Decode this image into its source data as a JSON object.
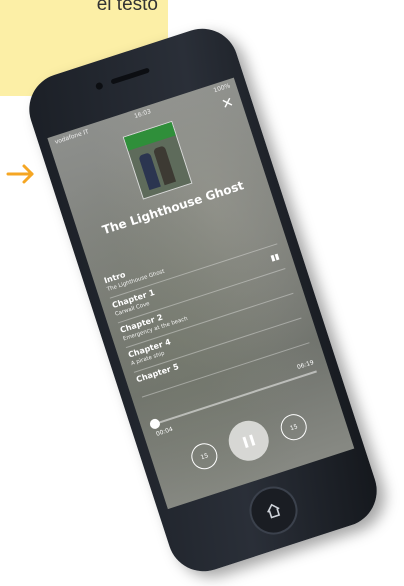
{
  "callout": {
    "text": "el testo"
  },
  "colors": {
    "callout_bg": "#fcefa6",
    "arrow": "#f5a623",
    "phone_body": "#1b1f26"
  },
  "status_bar": {
    "carrier": "vodafone IT",
    "time": "16:03",
    "battery": "100%"
  },
  "player": {
    "close_icon": "close-icon",
    "book_title": "The Lighthouse Ghost",
    "chapters": [
      {
        "title": "Intro",
        "subtitle": "The Lighthouse Ghost"
      },
      {
        "title": "Chapter 1",
        "subtitle": "Carwall Cove",
        "icon": "now-playing-icon"
      },
      {
        "title": "Chapter 2",
        "subtitle": "Emergency at the beach"
      },
      {
        "title": "Chapter 4",
        "subtitle": "A pirate ship"
      },
      {
        "title": "Chapter 5",
        "subtitle": ""
      }
    ],
    "elapsed": "00:04",
    "total": "06:19",
    "progress": 0.01,
    "skip_back_label": "15",
    "skip_forward_label": "15",
    "pause_icon": "pause-icon"
  }
}
